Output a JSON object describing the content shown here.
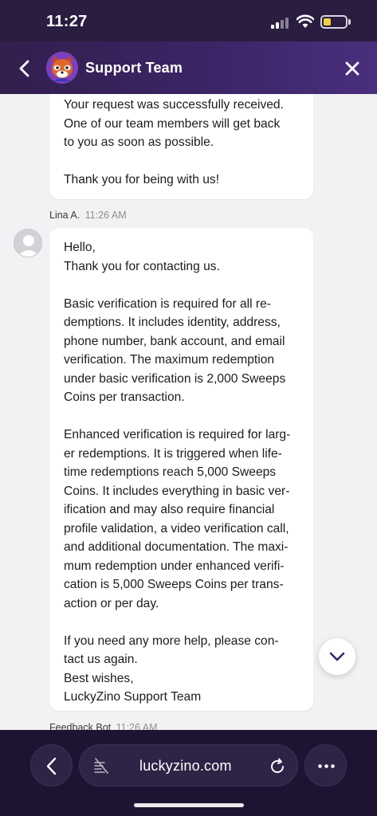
{
  "status_bar": {
    "time": "11:27"
  },
  "header": {
    "title": "Support Team"
  },
  "messages": {
    "first": {
      "lines": [
        "Your request was successfully received.",
        "One of our team members will get back",
        "to you as soon as possible.",
        "",
        "Thank you for being with us!"
      ]
    },
    "second": {
      "sender": "Lina A.",
      "time": "11:26 AM",
      "lines": [
        "Hello,",
        "Thank you for contacting us.",
        "",
        "Basic verification is required for all re-",
        "demptions. It includes identity, address,",
        "phone number, bank account, and email",
        "verification. The maximum redemption",
        "under basic verification is 2,000 Sweeps",
        "Coins per transaction.",
        "",
        "Enhanced verification is required for larg-",
        "er redemptions. It is triggered when life-",
        "time redemptions reach 5,000 Sweeps",
        "Coins. It includes everything in basic ver-",
        "ification and may also require financial",
        "profile validation, a video verification call,",
        "and additional documentation. The maxi-",
        "mum redemption under enhanced verifi-",
        "cation is 5,000 Sweeps Coins per trans-",
        "action or per day.",
        "",
        "If you need any more help, please con-",
        "tact us again.",
        "Best wishes,",
        "LuckyZino Support Team"
      ]
    },
    "third": {
      "sender": "Feedback Bot",
      "time": "11:26 AM"
    }
  },
  "browser": {
    "url": "luckyzino.com"
  },
  "icons": {
    "back": "chevron-left-icon",
    "close": "close-icon",
    "scroll": "chevron-down-icon",
    "reader": "reader-off-icon",
    "reload": "reload-icon",
    "more": "more-icon"
  },
  "colors": {
    "header": "#3b2566",
    "browser_bar": "#1e1432",
    "background": "#f2f2f4"
  }
}
